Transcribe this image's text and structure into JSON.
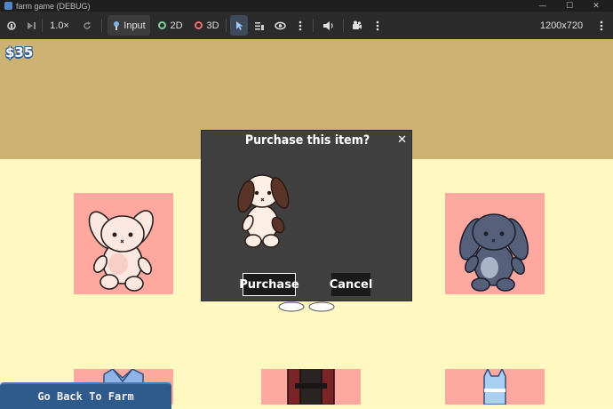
{
  "window": {
    "title": "farm game (DEBUG)"
  },
  "toolbar": {
    "zoom": "1.0×",
    "input_label": "Input",
    "mode_2d_label": "2D",
    "mode_3d_label": "3D",
    "resolution": "1200x720"
  },
  "game": {
    "money": "$35",
    "back_button_label": "Go Back To Farm"
  },
  "modal": {
    "title": "Purchase this item?",
    "close_glyph": "✕",
    "purchase_label": "Purchase",
    "cancel_label": "Cancel"
  },
  "colors": {
    "sky": "#ccb273",
    "ground": "#fff8c0",
    "tile": "#ffa8a0",
    "modal_bg": "#404040",
    "back_button": "#2f5b8c"
  }
}
